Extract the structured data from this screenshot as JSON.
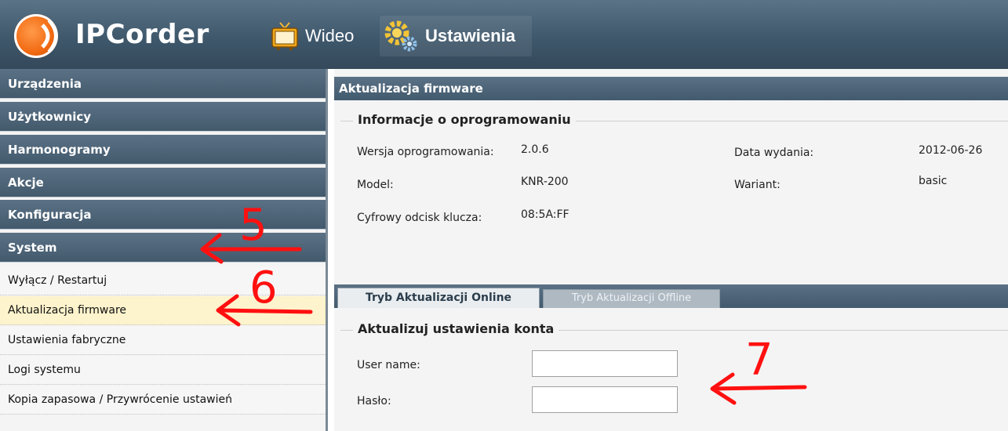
{
  "app": {
    "brand": "IPCorder",
    "nav": [
      {
        "label": "Wideo",
        "icon": "tv-icon"
      },
      {
        "label": "Ustawienia",
        "icon": "gear-icon"
      }
    ]
  },
  "sidebar": {
    "categories": [
      "Urządzenia",
      "Użytkownicy",
      "Harmonogramy",
      "Akcje",
      "Konfiguracja",
      "System"
    ],
    "items": [
      "Wyłącz / Restartuj",
      "Aktualizacja firmware",
      "Ustawienia fabryczne",
      "Logi systemu",
      "Kopia zapasowa / Przywrócenie ustawień"
    ],
    "active_item": "Aktualizacja firmware"
  },
  "main": {
    "title": "Aktualizacja firmware",
    "info": {
      "legend": "Informacje o oprogramowaniu",
      "version_label": "Wersja oprogramowania:",
      "version": "2.0.6",
      "model_label": "Model:",
      "model": "KNR-200",
      "fingerprint_label": "Cyfrowy odcisk klucza:",
      "fingerprint": "08:5A:FF",
      "release_label": "Data wydania:",
      "release": "2012-06-26",
      "variant_label": "Wariant:",
      "variant": "basic"
    },
    "tabs": [
      "Tryb Aktualizacji Online",
      "Tryb Aktualizacji Offline"
    ],
    "active_tab": "Tryb Aktualizacji Online",
    "account": {
      "legend": "Aktualizuj ustawienia konta",
      "username_label": "User name:",
      "username_value": "",
      "password_label": "Hasło:",
      "password_value": ""
    }
  },
  "annotations": [
    "5",
    "6",
    "7"
  ],
  "colors": {
    "header_bg": "#3f586c",
    "category_bg": "#4c6376",
    "active_item_bg": "#fdf3cc",
    "annotation": "#ff1010",
    "logo": "#f26a12"
  }
}
